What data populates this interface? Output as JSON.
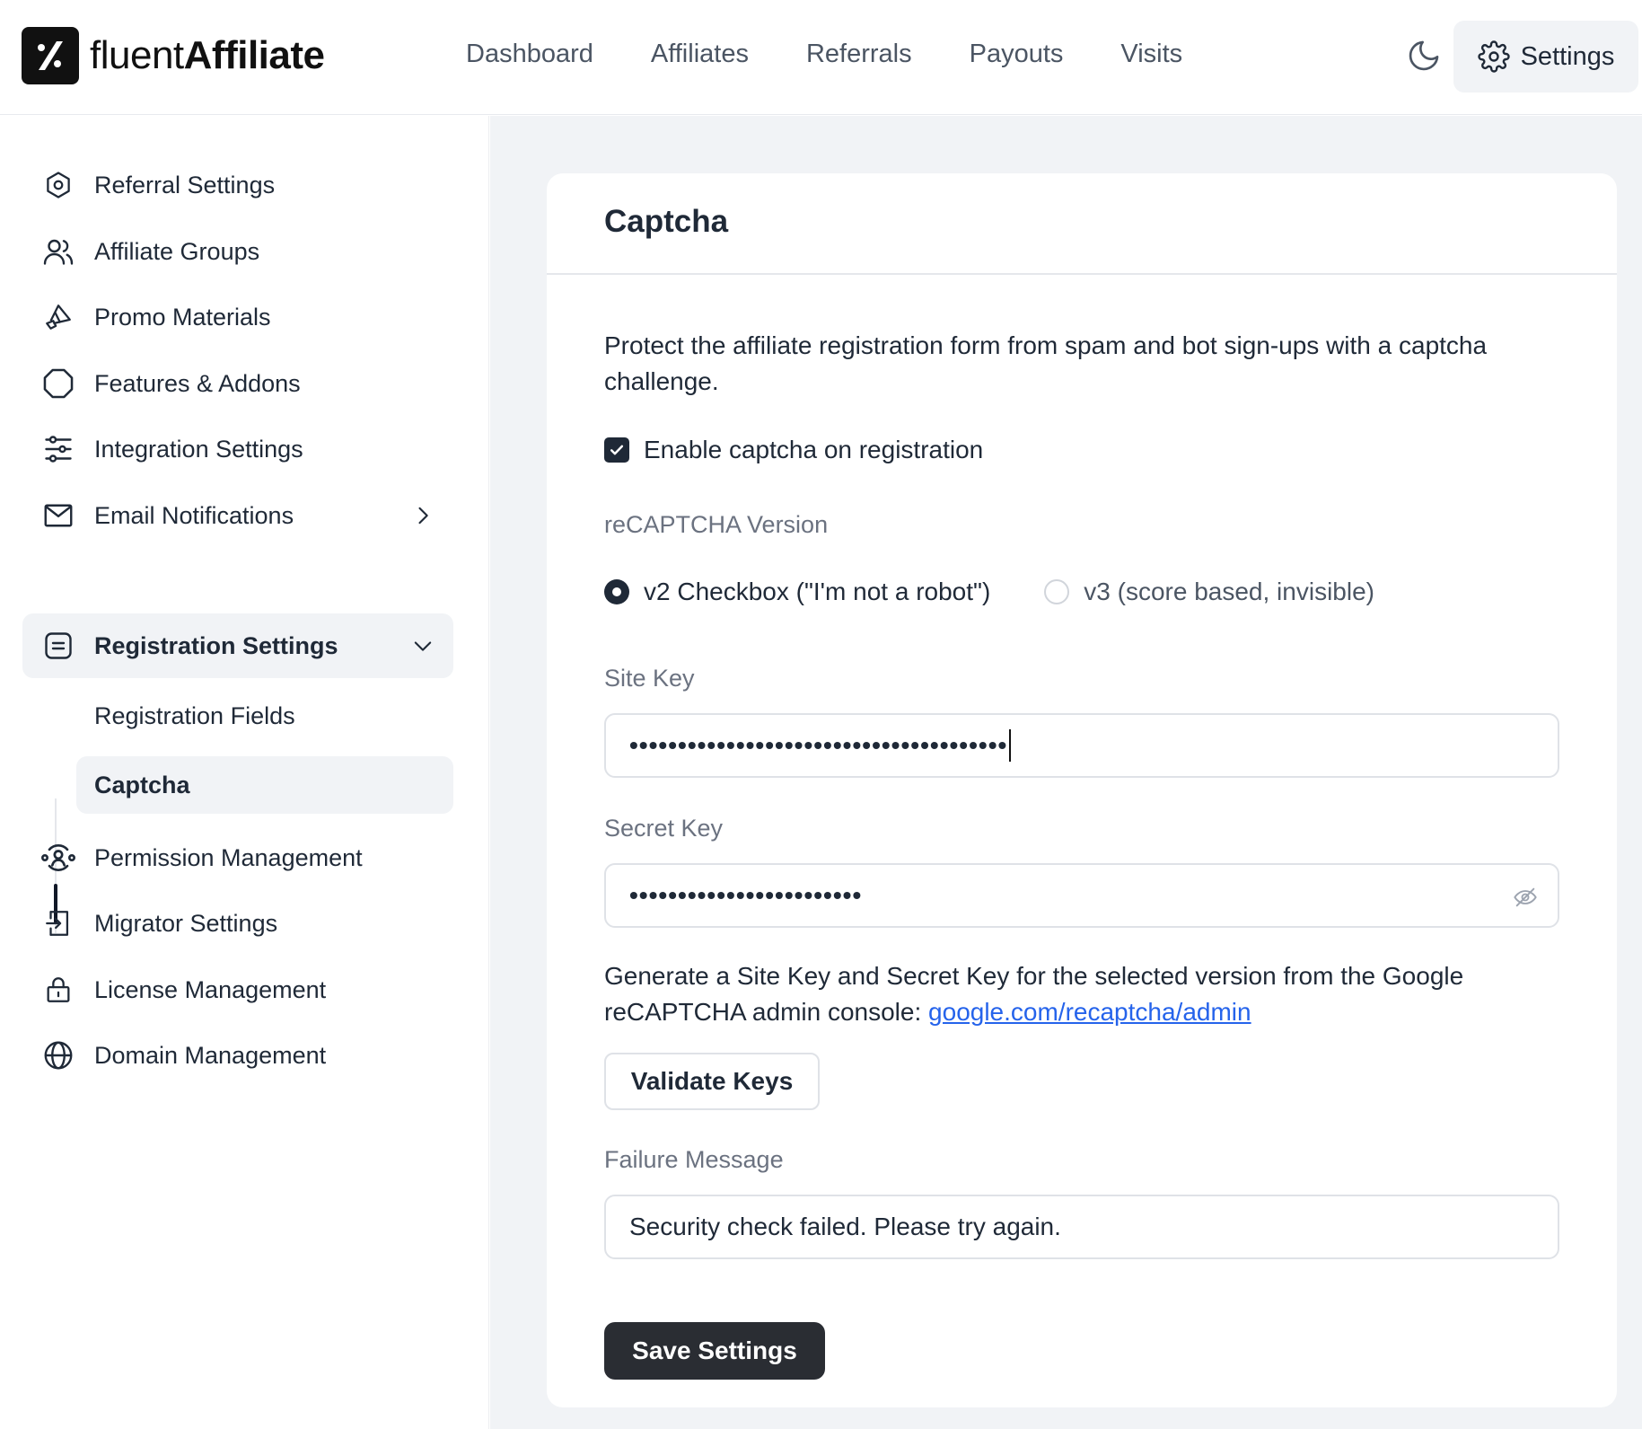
{
  "brand": {
    "name_light": "fluent",
    "name_bold": "Affiliate"
  },
  "topnav": [
    "Dashboard",
    "Affiliates",
    "Referrals",
    "Payouts",
    "Visits"
  ],
  "settings_label": "Settings",
  "sidebar": {
    "items": [
      {
        "label": "Referral Settings",
        "icon": "hexagon-cog-icon"
      },
      {
        "label": "Affiliate Groups",
        "icon": "users-icon"
      },
      {
        "label": "Promo Materials",
        "icon": "megaphone-icon"
      },
      {
        "label": "Features & Addons",
        "icon": "diamond-icon"
      },
      {
        "label": "Integration Settings",
        "icon": "sliders-icon"
      },
      {
        "label": "Email Notifications",
        "icon": "mail-icon"
      },
      {
        "label": "Registration Settings",
        "icon": "form-icon"
      },
      {
        "label": "Permission Management",
        "icon": "permission-icon"
      },
      {
        "label": "Migrator Settings",
        "icon": "import-icon"
      },
      {
        "label": "License Management",
        "icon": "lock-icon"
      },
      {
        "label": "Domain Management",
        "icon": "globe-icon"
      }
    ],
    "sub_items": [
      {
        "label": "Registration Fields"
      },
      {
        "label": "Captcha"
      }
    ]
  },
  "card": {
    "title": "Captcha",
    "description": "Protect the affiliate registration form from spam and bot sign-ups with a captcha challenge.",
    "enable_label": "Enable captcha on registration",
    "enable_checked": true,
    "version_label": "reCAPTCHA Version",
    "version_options": [
      "v2 Checkbox (\"I'm not a robot\")",
      "v3 (score based, invisible)"
    ],
    "version_selected": "v2 Checkbox (\"I'm not a robot\")",
    "site_key_label": "Site Key",
    "site_key_value": "•••••••••••••••••••••••••••••••••••••••",
    "secret_key_label": "Secret Key",
    "secret_key_value": "••••••••••••••••••••••••",
    "help_text": "Generate a Site Key and Secret Key for the selected version from the Google reCAPTCHA admin console: ",
    "help_link": "google.com/recaptcha/admin",
    "validate_label": "Validate Keys",
    "failure_label": "Failure Message",
    "failure_value": "Security check failed. Please try again.",
    "save_label": "Save Settings"
  },
  "colors": {
    "accent": "#1f2937",
    "link": "#2563eb",
    "bg_main": "#f1f3f6"
  }
}
